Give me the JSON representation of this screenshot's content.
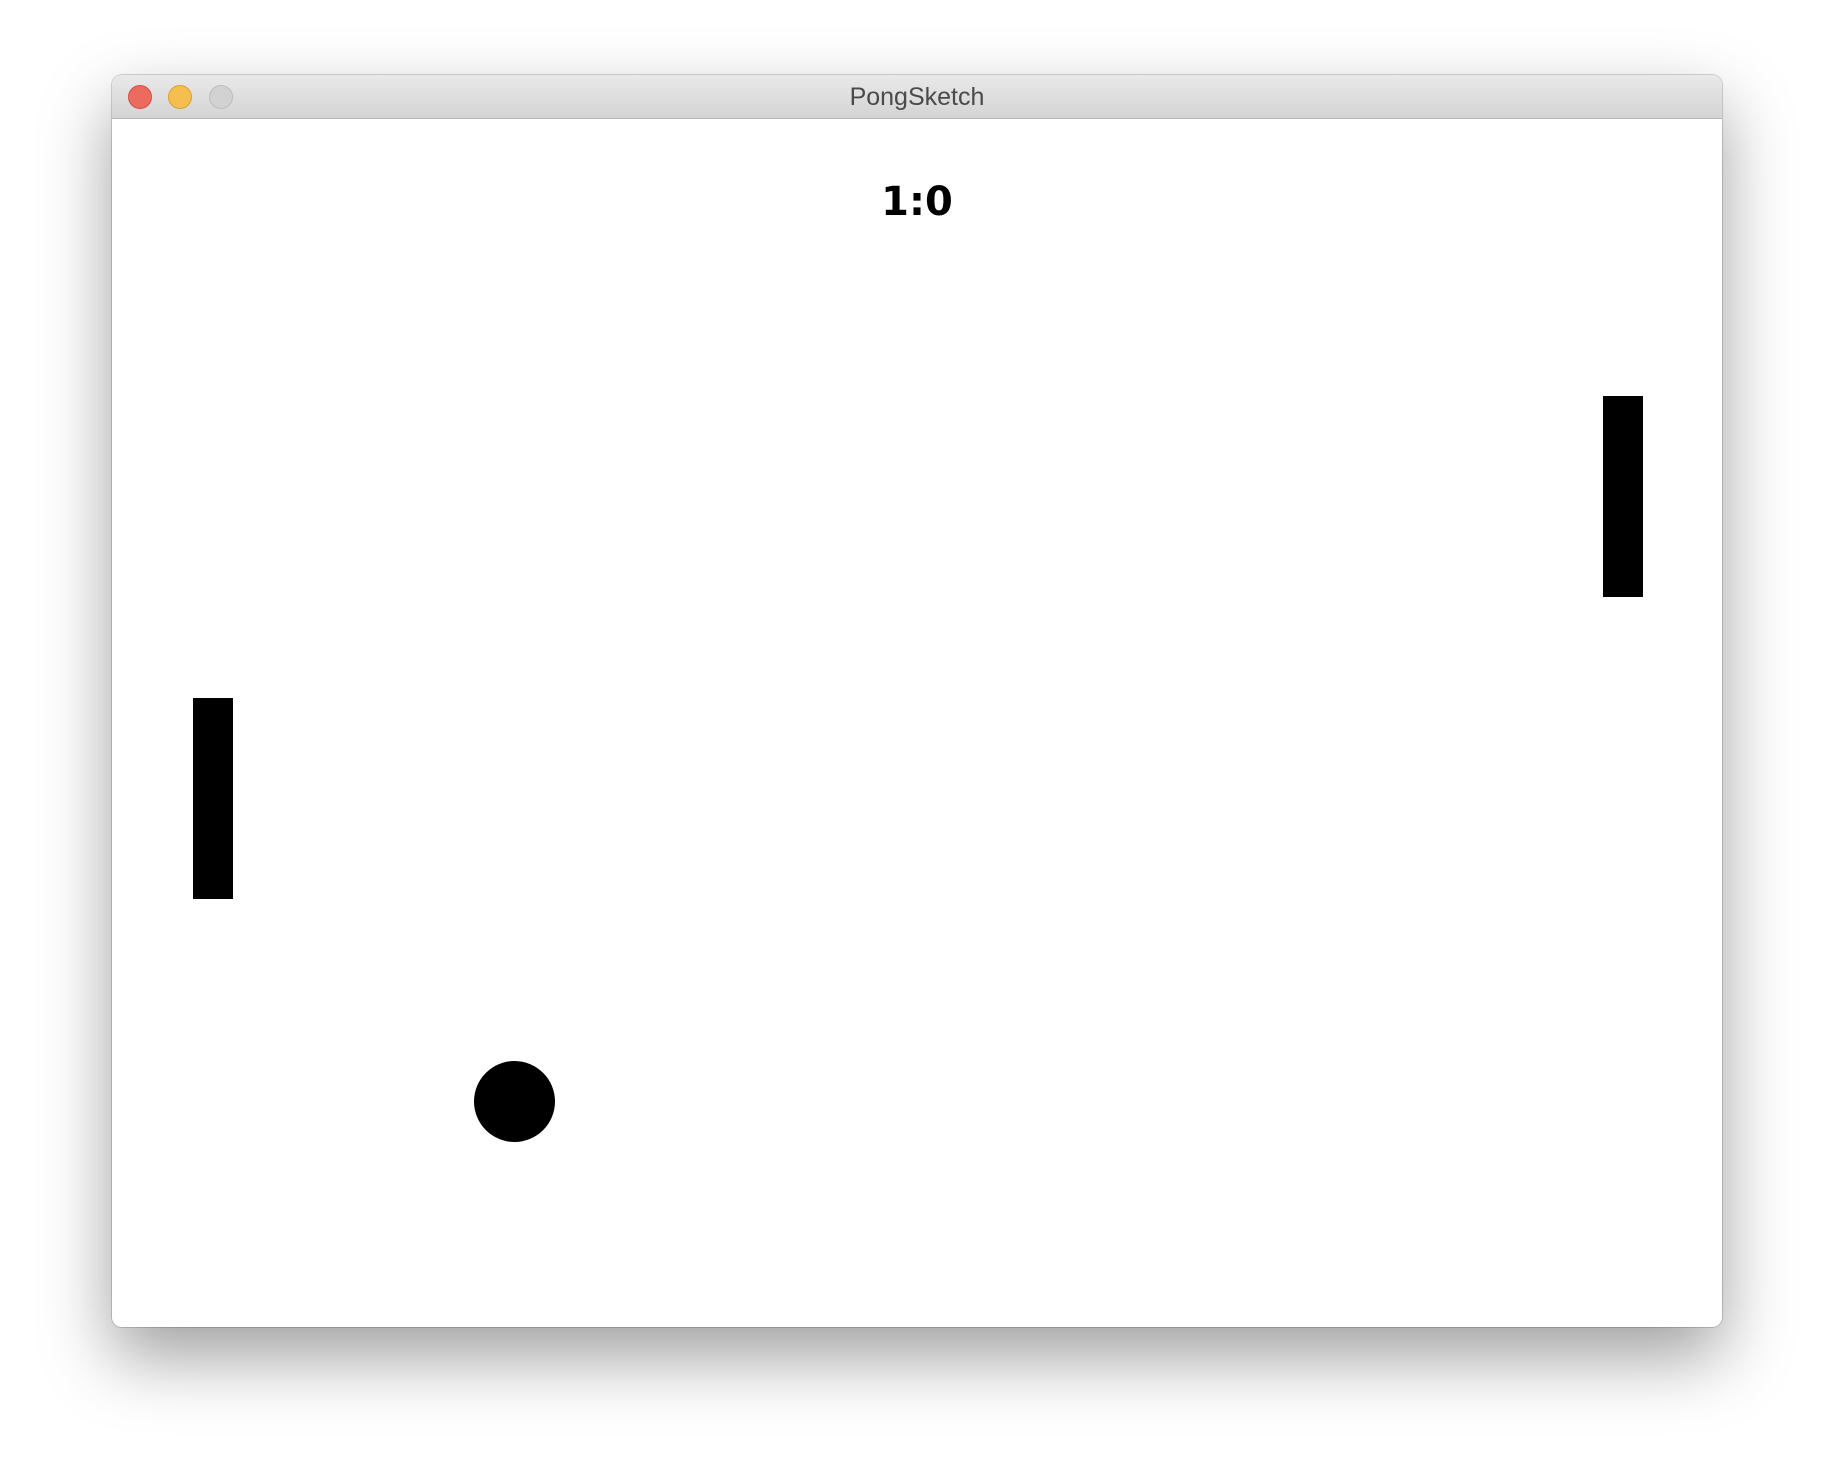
{
  "window": {
    "title": "PongSketch"
  },
  "game": {
    "score": "1:0"
  },
  "colors": {
    "close": "#ed6a5e",
    "minimize": "#f5bf4f",
    "zoom_disabled": "#d2d2d2",
    "canvas_background": "#ffffff",
    "game_objects": "#000000"
  },
  "icons": {
    "close": "close-button-icon",
    "minimize": "minimize-button-icon",
    "zoom": "zoom-button-icon"
  }
}
